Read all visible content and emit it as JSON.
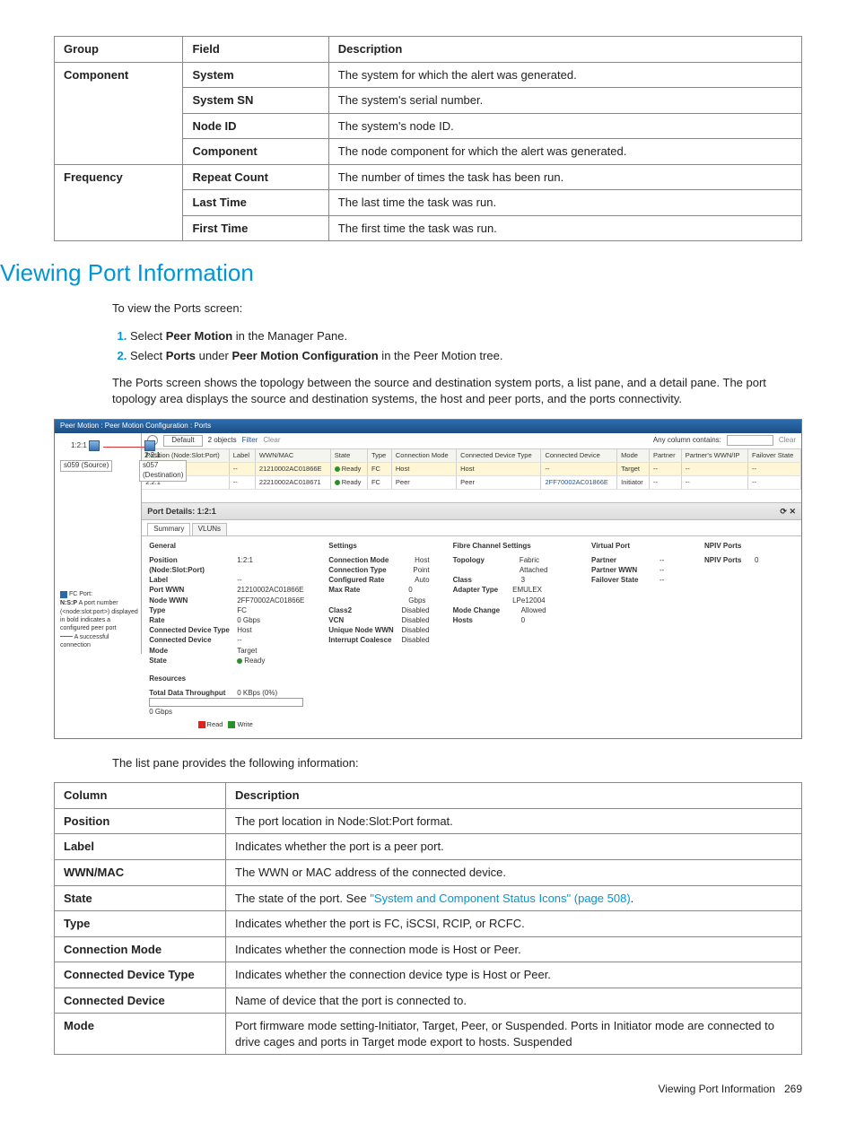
{
  "table1": {
    "head": [
      "Group",
      "Field",
      "Description"
    ],
    "rows": [
      {
        "g": "Component",
        "f": "System",
        "d": "The system for which the alert was generated."
      },
      {
        "g": "",
        "f": "System SN",
        "d": "The system's serial number."
      },
      {
        "g": "",
        "f": "Node ID",
        "d": "The system's node ID."
      },
      {
        "g": "",
        "f": "Component",
        "d": "The node component for which the alert was generated."
      },
      {
        "g": "Frequency",
        "f": "Repeat Count",
        "d": "The number of times the task has been run."
      },
      {
        "g": "",
        "f": "Last Time",
        "d": "The last time the task was run."
      },
      {
        "g": "",
        "f": "First Time",
        "d": "The first time the task was run."
      }
    ]
  },
  "heading": "Viewing Port Information",
  "intro": "To view the Ports screen:",
  "steps": {
    "s1a": "Select ",
    "s1b": "Peer Motion",
    "s1c": " in the Manager Pane.",
    "s2a": "Select ",
    "s2b": "Ports",
    "s2c": " under ",
    "s2d": "Peer Motion Configuration",
    "s2e": " in the Peer Motion tree."
  },
  "para": "The Ports screen shows the topology between the source and destination system ports, a list pane, and a detail pane. The port topology area displays the source and destination systems, the host and peer ports, and the ports connectivity.",
  "screenshot": {
    "title": "Peer Motion : Peer Motion Configuration : Ports",
    "toolbar": {
      "default": "Default",
      "objects": "2 objects",
      "filter": "Filter",
      "clear": "Clear",
      "anycol": "Any column contains:"
    },
    "topo": {
      "p1": "1:2:1",
      "p2": "2:2:1",
      "s1": "s059 (Source)",
      "s2": "s057 (Destination)"
    },
    "legend": {
      "fc": "FC Port:",
      "nsp": "A port number (<node:slot:port>) displayed in bold indicates a configured peer port",
      "succ": "A successful connection"
    },
    "cols": [
      "Position\n(Node:Slot:Port)",
      "Label",
      "WWN/MAC",
      "State",
      "Type",
      "Connection Mode",
      "Connected Device Type",
      "Connected Device",
      "Mode",
      "Partner",
      "Partner's WWN/IP",
      "Failover State"
    ],
    "r1": {
      "pos": "1:2:1",
      "label": "--",
      "wwn": "21210002AC01866E",
      "state": "Ready",
      "type": "FC",
      "cmode": "Host",
      "cdt": "Host",
      "cdev": "--",
      "mode": "Target",
      "partner": "--",
      "pw": "--",
      "fo": "--"
    },
    "r2": {
      "pos": "2:2:1",
      "label": "--",
      "wwn": "22210002AC018671",
      "state": "Ready",
      "type": "FC",
      "cmode": "Peer",
      "cdt": "Peer",
      "cdev": "2FF70002AC01866E",
      "mode": "Initiator",
      "partner": "--",
      "pw": "--",
      "fo": "--"
    },
    "detailTitle": "Port Details: 1:2:1",
    "tabs": [
      "Summary",
      "VLUNs"
    ],
    "general": {
      "hd": "General",
      "pos": "1:2:1",
      "label": "--",
      "pwwn": "21210002AC01866E",
      "nwwn": "2FF70002AC01866E",
      "type": "FC",
      "rate": "0 Gbps",
      "cdt": "Host",
      "cdev": "--",
      "mode": "Target",
      "state": "Ready",
      "k": {
        "pos": "Position (Node:Slot:Port)",
        "label": "Label",
        "pwwn": "Port WWN",
        "nwwn": "Node WWN",
        "type": "Type",
        "rate": "Rate",
        "cdt": "Connected Device Type",
        "cdev": "Connected Device",
        "mode": "Mode",
        "state": "State"
      }
    },
    "settings": {
      "hd": "Settings",
      "k": {
        "cmode": "Connection Mode",
        "ctype": "Connection Type",
        "crate": "Configured Rate",
        "mrate": "Max Rate",
        "c2": "Class2",
        "vcn": "VCN",
        "unw": "Unique Node WWN",
        "ic": "Interrupt Coalesce"
      },
      "cmode": "Host",
      "ctype": "Point",
      "crate": "Auto",
      "mrate": "0 Gbps",
      "c2": "Disabled",
      "vcn": "Disabled",
      "unw": "Disabled",
      "ic": "Disabled"
    },
    "fcs": {
      "hd": "Fibre Channel Settings",
      "k": {
        "topo": "Topology",
        "class": "Class",
        "at": "Adapter Type",
        "mc": "Mode Change",
        "hosts": "Hosts"
      },
      "topo": "Fabric Attached",
      "class": "3",
      "at": "EMULEX LPe12004",
      "mc": "Allowed",
      "hosts": "0"
    },
    "vp": {
      "hd": "Virtual Port",
      "k": {
        "partner": "Partner",
        "pwwn": "Partner WWN",
        "fstate": "Failover State"
      },
      "partner": "--",
      "pwwn": "--",
      "fstate": "--"
    },
    "npiv": {
      "hd": "NPIV Ports",
      "k": "NPIV Ports",
      "v": "0"
    },
    "resources": {
      "hd": "Resources",
      "k": "Total Data Throughput",
      "v": "0 KBps (0%)",
      "rate": "0 Gbps",
      "read": "Read",
      "write": "Write"
    }
  },
  "listIntro": "The list pane provides the following information:",
  "table2": {
    "head": [
      "Column",
      "Description"
    ],
    "rows": [
      {
        "c": "Position",
        "d": "The port location in Node:Slot:Port format."
      },
      {
        "c": "Label",
        "d": "Indicates whether the port is a peer port."
      },
      {
        "c": "WWN/MAC",
        "d": "The WWN or MAC address of the connected device."
      },
      {
        "c": "State",
        "d_pre": "The state of the port. See ",
        "d_link": "\"System and Component Status Icons\" (page 508)",
        "d_post": "."
      },
      {
        "c": "Type",
        "d": "Indicates whether the port is FC, iSCSI, RCIP, or RCFC."
      },
      {
        "c": "Connection Mode",
        "d": "Indicates whether the connection mode is Host or Peer."
      },
      {
        "c": "Connected Device Type",
        "d": "Indicates whether the connection device type is Host or Peer."
      },
      {
        "c": "Connected Device",
        "d": "Name of device that the port is connected to."
      },
      {
        "c": "Mode",
        "d": "Port firmware mode setting-Initiator, Target, Peer, or Suspended. Ports in Initiator mode are connected to drive cages and ports in Target mode export to hosts. Suspended"
      }
    ]
  },
  "labels": {
    "nsp": "N:S:P"
  },
  "footer": {
    "title": "Viewing Port Information",
    "page": "269"
  }
}
